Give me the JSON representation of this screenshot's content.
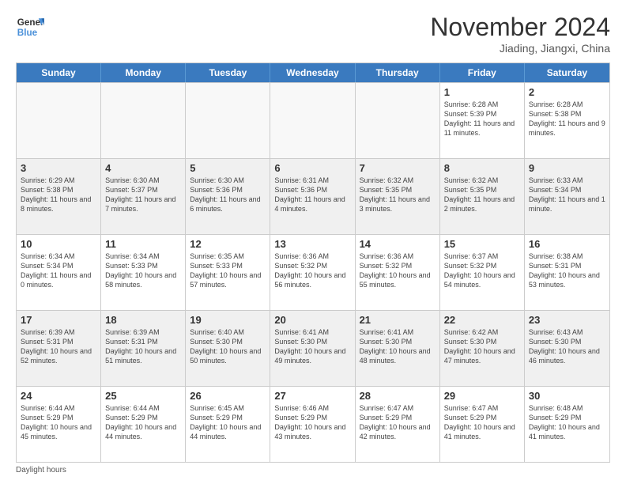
{
  "header": {
    "logo_line1": "General",
    "logo_line2": "Blue",
    "month_title": "November 2024",
    "subtitle": "Jiading, Jiangxi, China"
  },
  "days_of_week": [
    "Sunday",
    "Monday",
    "Tuesday",
    "Wednesday",
    "Thursday",
    "Friday",
    "Saturday"
  ],
  "weeks": [
    [
      {
        "day": "",
        "empty": true
      },
      {
        "day": "",
        "empty": true
      },
      {
        "day": "",
        "empty": true
      },
      {
        "day": "",
        "empty": true
      },
      {
        "day": "",
        "empty": true
      },
      {
        "day": "1",
        "info": "Sunrise: 6:28 AM\nSunset: 5:39 PM\nDaylight: 11 hours and 11 minutes."
      },
      {
        "day": "2",
        "info": "Sunrise: 6:28 AM\nSunset: 5:38 PM\nDaylight: 11 hours and 9 minutes."
      }
    ],
    [
      {
        "day": "3",
        "info": "Sunrise: 6:29 AM\nSunset: 5:38 PM\nDaylight: 11 hours and 8 minutes."
      },
      {
        "day": "4",
        "info": "Sunrise: 6:30 AM\nSunset: 5:37 PM\nDaylight: 11 hours and 7 minutes."
      },
      {
        "day": "5",
        "info": "Sunrise: 6:30 AM\nSunset: 5:36 PM\nDaylight: 11 hours and 6 minutes."
      },
      {
        "day": "6",
        "info": "Sunrise: 6:31 AM\nSunset: 5:36 PM\nDaylight: 11 hours and 4 minutes."
      },
      {
        "day": "7",
        "info": "Sunrise: 6:32 AM\nSunset: 5:35 PM\nDaylight: 11 hours and 3 minutes."
      },
      {
        "day": "8",
        "info": "Sunrise: 6:32 AM\nSunset: 5:35 PM\nDaylight: 11 hours and 2 minutes."
      },
      {
        "day": "9",
        "info": "Sunrise: 6:33 AM\nSunset: 5:34 PM\nDaylight: 11 hours and 1 minute."
      }
    ],
    [
      {
        "day": "10",
        "info": "Sunrise: 6:34 AM\nSunset: 5:34 PM\nDaylight: 11 hours and 0 minutes."
      },
      {
        "day": "11",
        "info": "Sunrise: 6:34 AM\nSunset: 5:33 PM\nDaylight: 10 hours and 58 minutes."
      },
      {
        "day": "12",
        "info": "Sunrise: 6:35 AM\nSunset: 5:33 PM\nDaylight: 10 hours and 57 minutes."
      },
      {
        "day": "13",
        "info": "Sunrise: 6:36 AM\nSunset: 5:32 PM\nDaylight: 10 hours and 56 minutes."
      },
      {
        "day": "14",
        "info": "Sunrise: 6:36 AM\nSunset: 5:32 PM\nDaylight: 10 hours and 55 minutes."
      },
      {
        "day": "15",
        "info": "Sunrise: 6:37 AM\nSunset: 5:32 PM\nDaylight: 10 hours and 54 minutes."
      },
      {
        "day": "16",
        "info": "Sunrise: 6:38 AM\nSunset: 5:31 PM\nDaylight: 10 hours and 53 minutes."
      }
    ],
    [
      {
        "day": "17",
        "info": "Sunrise: 6:39 AM\nSunset: 5:31 PM\nDaylight: 10 hours and 52 minutes."
      },
      {
        "day": "18",
        "info": "Sunrise: 6:39 AM\nSunset: 5:31 PM\nDaylight: 10 hours and 51 minutes."
      },
      {
        "day": "19",
        "info": "Sunrise: 6:40 AM\nSunset: 5:30 PM\nDaylight: 10 hours and 50 minutes."
      },
      {
        "day": "20",
        "info": "Sunrise: 6:41 AM\nSunset: 5:30 PM\nDaylight: 10 hours and 49 minutes."
      },
      {
        "day": "21",
        "info": "Sunrise: 6:41 AM\nSunset: 5:30 PM\nDaylight: 10 hours and 48 minutes."
      },
      {
        "day": "22",
        "info": "Sunrise: 6:42 AM\nSunset: 5:30 PM\nDaylight: 10 hours and 47 minutes."
      },
      {
        "day": "23",
        "info": "Sunrise: 6:43 AM\nSunset: 5:30 PM\nDaylight: 10 hours and 46 minutes."
      }
    ],
    [
      {
        "day": "24",
        "info": "Sunrise: 6:44 AM\nSunset: 5:29 PM\nDaylight: 10 hours and 45 minutes."
      },
      {
        "day": "25",
        "info": "Sunrise: 6:44 AM\nSunset: 5:29 PM\nDaylight: 10 hours and 44 minutes."
      },
      {
        "day": "26",
        "info": "Sunrise: 6:45 AM\nSunset: 5:29 PM\nDaylight: 10 hours and 44 minutes."
      },
      {
        "day": "27",
        "info": "Sunrise: 6:46 AM\nSunset: 5:29 PM\nDaylight: 10 hours and 43 minutes."
      },
      {
        "day": "28",
        "info": "Sunrise: 6:47 AM\nSunset: 5:29 PM\nDaylight: 10 hours and 42 minutes."
      },
      {
        "day": "29",
        "info": "Sunrise: 6:47 AM\nSunset: 5:29 PM\nDaylight: 10 hours and 41 minutes."
      },
      {
        "day": "30",
        "info": "Sunrise: 6:48 AM\nSunset: 5:29 PM\nDaylight: 10 hours and 41 minutes."
      }
    ]
  ],
  "footer": "Daylight hours"
}
